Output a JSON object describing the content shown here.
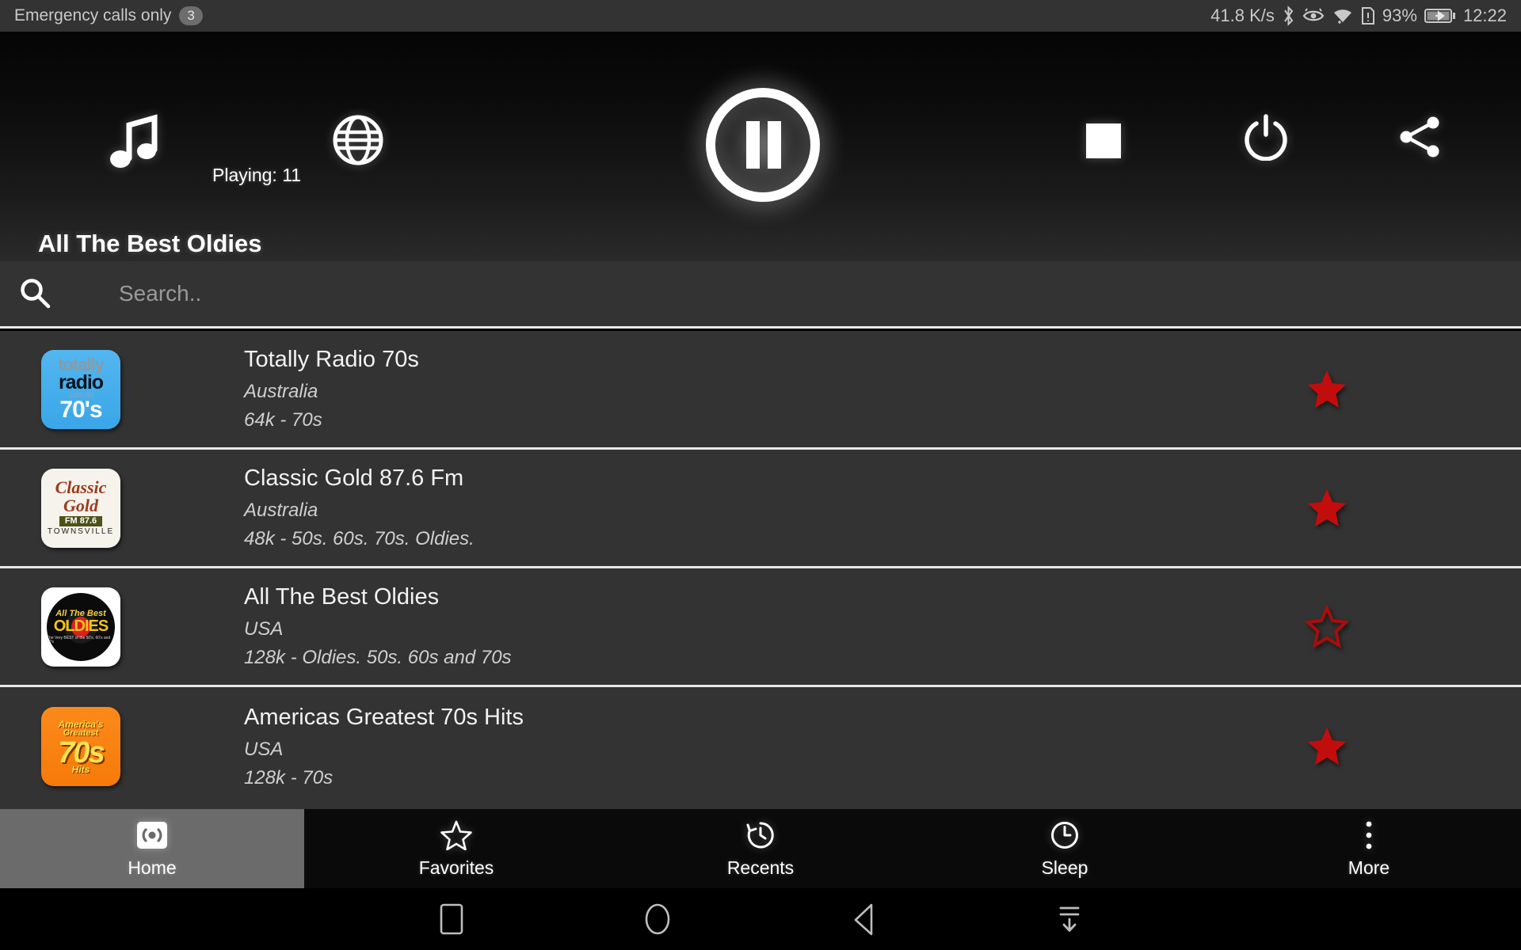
{
  "status_bar": {
    "carrier_text": "Emergency calls only",
    "notification_count": "3",
    "network_speed": "41.8 K/s",
    "battery_percent": "93%",
    "clock": "12:22",
    "icons": [
      "bluetooth-icon",
      "eye-icon",
      "wifi-icon",
      "sim-alert-icon",
      "battery-charging-icon"
    ]
  },
  "player": {
    "music_icon": "music-note-icon",
    "globe_icon": "globe-icon",
    "playing_label": "Playing: 11",
    "play_pause_icon": "pause-icon",
    "stop_icon": "stop-icon",
    "power_icon": "power-icon",
    "share_icon": "share-icon",
    "now_playing_title": "All The Best Oldies"
  },
  "search": {
    "icon": "search-icon",
    "placeholder": "Search..",
    "value": ""
  },
  "stations": [
    {
      "name": "Totally Radio 70s",
      "country": "Australia",
      "meta": "64k - 70s",
      "favorite": true,
      "logo": "totally-radio-70s-logo",
      "logo_lines": [
        "totally",
        "radio",
        ".com.au",
        "70's"
      ]
    },
    {
      "name": "Classic Gold 87.6 Fm",
      "country": "Australia",
      "meta": "48k - 50s. 60s. 70s. Oldies.",
      "favorite": true,
      "logo": "classic-gold-logo",
      "logo_lines": [
        "Classic",
        "Gold",
        "FM 87.6",
        "TOWNSVILLE"
      ]
    },
    {
      "name": "All The Best Oldies",
      "country": "USA",
      "meta": "128k - Oldies. 50s. 60s and 70s",
      "favorite": false,
      "logo": "all-the-best-oldies-logo",
      "logo_lines": [
        "All The Best",
        "OLDIES",
        "The Very BEST of the 50's, 60's and 70's"
      ]
    },
    {
      "name": "Americas Greatest 70s Hits",
      "country": "USA",
      "meta": "128k - 70s",
      "favorite": true,
      "logo": "americas-greatest-70s-hits-logo",
      "logo_lines": [
        "America's",
        "Greatest",
        "70s",
        "Hits"
      ]
    }
  ],
  "tabs": [
    {
      "label": "Home",
      "icon": "broadcast-icon",
      "active": true
    },
    {
      "label": "Favorites",
      "icon": "star-outline-icon",
      "active": false
    },
    {
      "label": "Recents",
      "icon": "history-icon",
      "active": false
    },
    {
      "label": "Sleep",
      "icon": "clock-icon",
      "active": false
    },
    {
      "label": "More",
      "icon": "more-vertical-icon",
      "active": false
    }
  ],
  "nav_bar": {
    "buttons": [
      "recents-square-icon",
      "home-circle-icon",
      "back-triangle-icon",
      "hide-keyboard-icon"
    ]
  },
  "colors": {
    "status_bar_bg": "#333333",
    "list_bg": "#333333",
    "divider": "#e8e8e8",
    "favorite_star": "#c20d0d",
    "active_tab_bg": "#6b6b6b"
  }
}
